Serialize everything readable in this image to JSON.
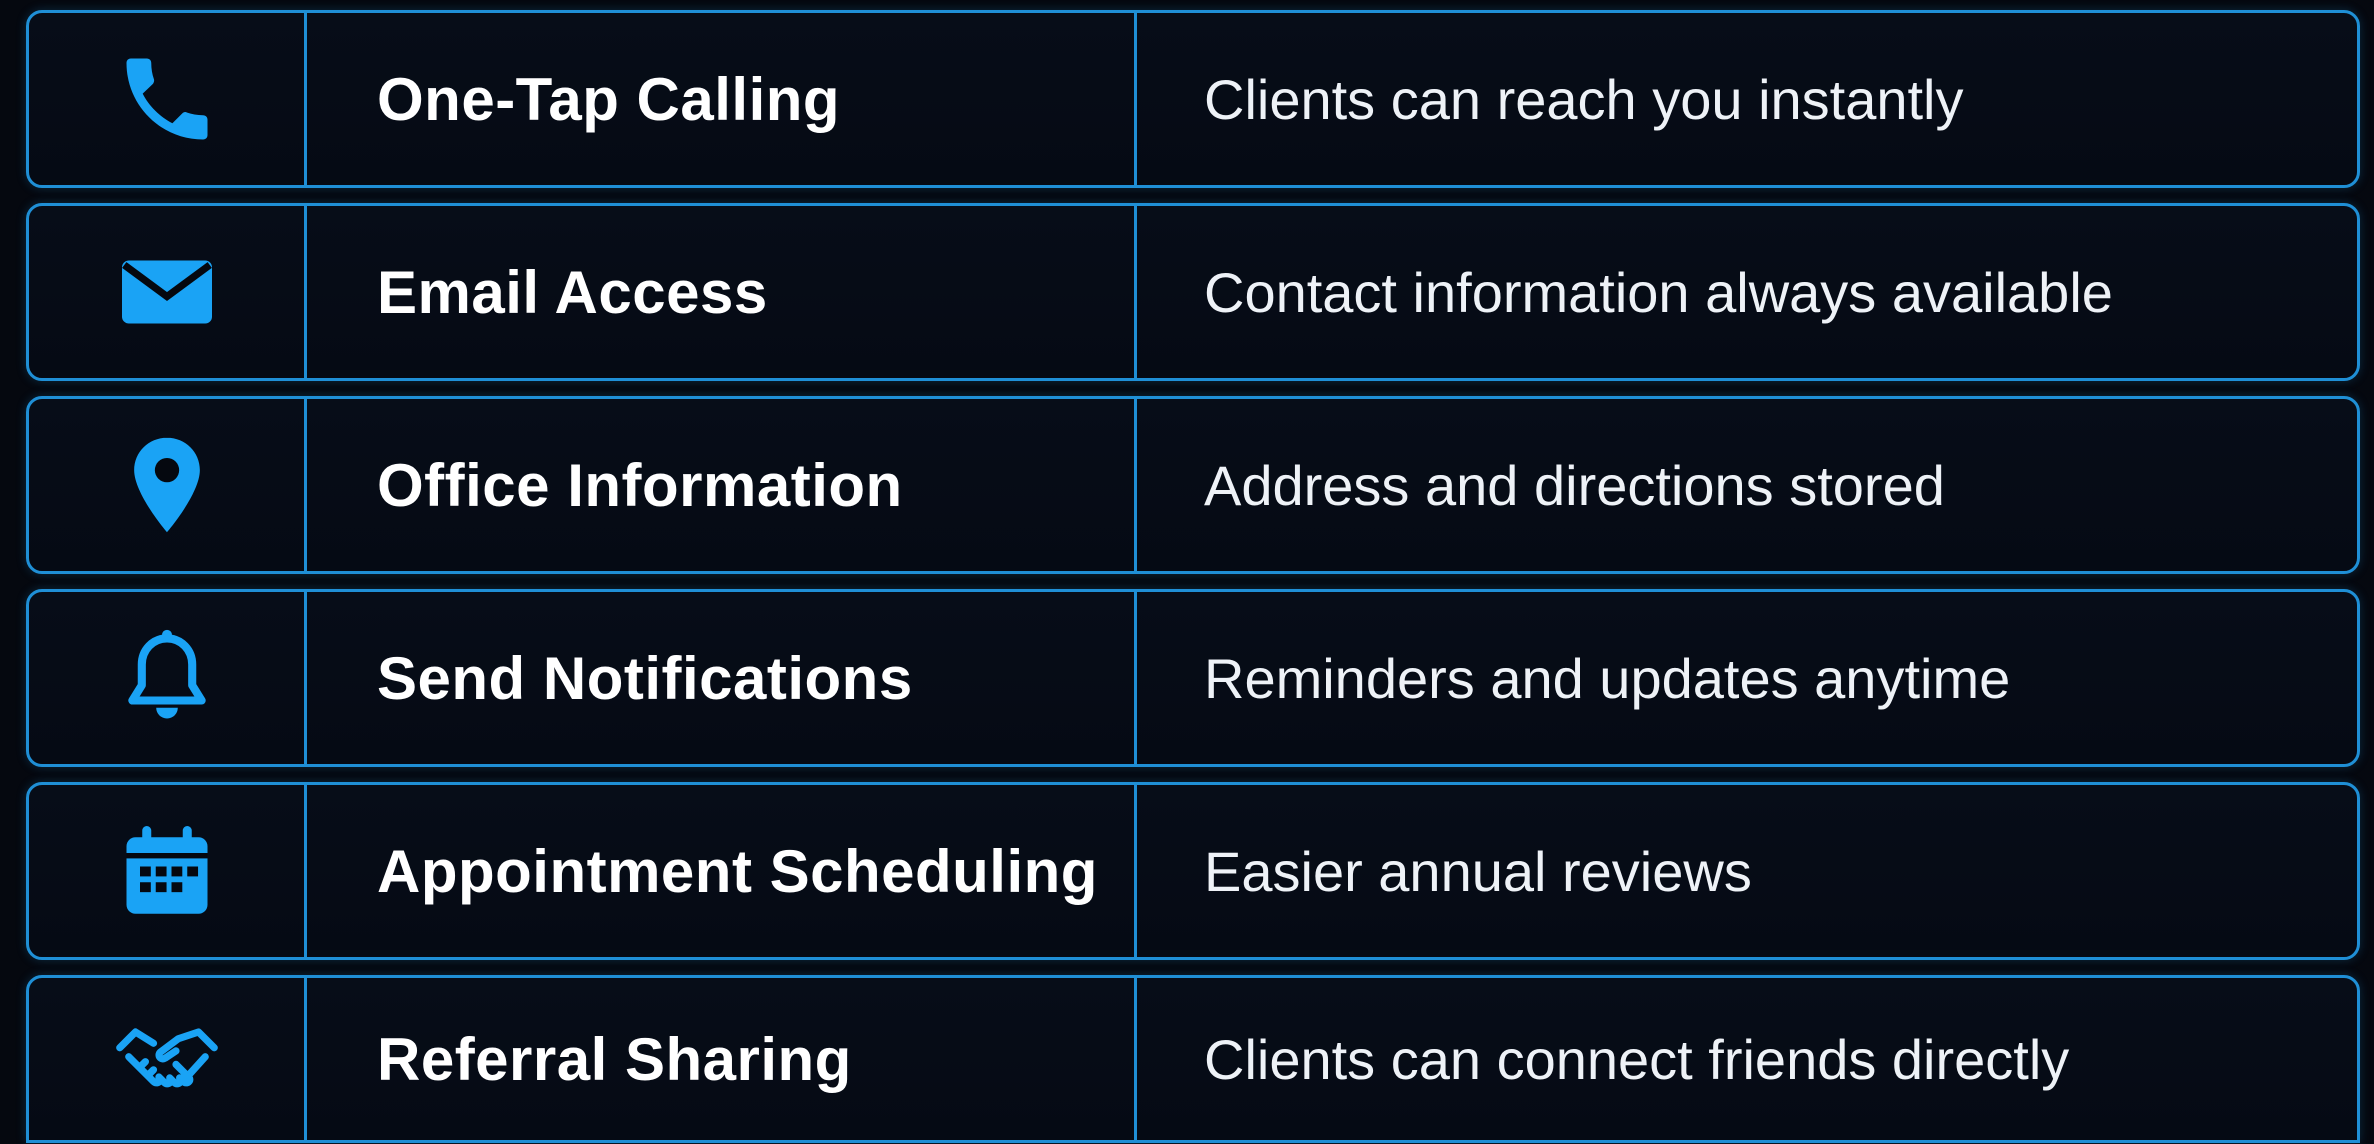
{
  "colors": {
    "background": "#05080f",
    "border": "#1f8fd6",
    "icon": "#1aa3f5",
    "text": "#ffffff"
  },
  "rows": [
    {
      "icon": "phone-icon",
      "feature": "One-Tap Calling",
      "description": "Clients can reach you instantly"
    },
    {
      "icon": "envelope-icon",
      "feature": "Email Access",
      "description": "Contact information always available"
    },
    {
      "icon": "location-pin-icon",
      "feature": "Office Information",
      "description": "Address and directions stored"
    },
    {
      "icon": "bell-icon",
      "feature": "Send Notifications",
      "description": "Reminders and updates anytime"
    },
    {
      "icon": "calendar-icon",
      "feature": "Appointment Scheduling",
      "description": "Easier annual reviews"
    },
    {
      "icon": "handshake-icon",
      "feature": "Referral Sharing",
      "description": "Clients can connect friends directly"
    }
  ]
}
